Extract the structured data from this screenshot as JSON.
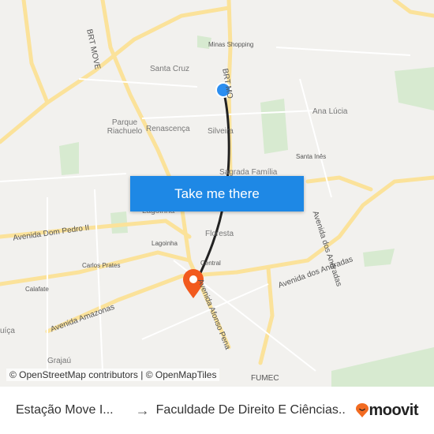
{
  "map": {
    "labels": {
      "brt_move_west": "BRT MOVE",
      "minas_shopping": "Minas Shopping",
      "santa_cruz": "Santa Cruz",
      "brt_move_east": "BRT MO",
      "parque_riachuelo": "Parque Riachuelo",
      "renascenca": "Renascença",
      "silveira": "Silveira",
      "ana_lucia": "Ana Lúcia",
      "santa_ines": "Santa Inês",
      "sagrada_familia": "Sagrada Família",
      "lagoinha_big": "Lagoinha",
      "avenida_dom_pedro": "Avenida Dom Pedro II",
      "floresta": "Floresta",
      "lagoinha_small": "Lagoinha",
      "carlos_prates": "Carlos Prates",
      "central": "Central",
      "avenida_dos_andradas": "Avenida dos Andradas",
      "avenida_andradas_vertical": "Avenida dos Andradas",
      "calafate": "Calafate",
      "avenida_amazonas": "Avenida Amazonas",
      "avenida_afonso_pena": "Avenida Afonso Pena",
      "gutierrez": "uíça",
      "grajau": "Grajaú",
      "fumec": "FUMEC"
    },
    "cta_label": "Take me there",
    "attribution": "© OpenStreetMap contributors | © OpenMapTiles",
    "colors": {
      "route": "#222222",
      "origin": "#2b8ef0",
      "destination": "#f25a1e",
      "road": "#fbe29a",
      "park": "#cfe8c4",
      "cta": "#1e88e5"
    }
  },
  "footer": {
    "from": "Estação Move I...",
    "arrow": "→",
    "to": "Faculdade De Direito E Ciências...",
    "brand": "moovit",
    "brand_color": "#f26b21"
  }
}
